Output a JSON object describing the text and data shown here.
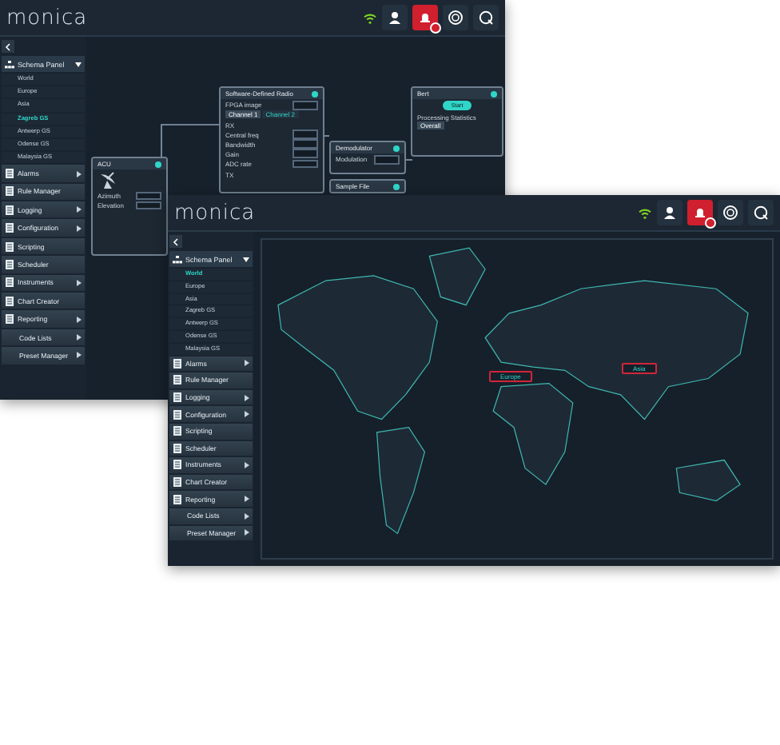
{
  "back_window": {
    "logo": "monica",
    "toolbar": {
      "alarm_active": true
    },
    "sidebar": {
      "schema_panel": {
        "label": "Schema Panel",
        "expanded": true,
        "items": [
          {
            "label": "World",
            "selected": false
          },
          {
            "label": "Europe",
            "selected": false
          },
          {
            "label": "Asia",
            "selected": false
          },
          {
            "label": "Zagreb GS",
            "selected": true
          },
          {
            "label": "Antwerp GS",
            "selected": false
          },
          {
            "label": "Odense GS",
            "selected": false
          },
          {
            "label": "Malaysia GS",
            "selected": false
          }
        ]
      },
      "menu": [
        {
          "label": "Alarms",
          "has_icon": true,
          "has_submenu": true
        },
        {
          "label": "Rule Manager",
          "has_icon": true,
          "has_submenu": false
        },
        {
          "label": "Logging",
          "has_icon": true,
          "has_submenu": true
        },
        {
          "label": "Configuration",
          "has_icon": true,
          "has_submenu": true
        },
        {
          "label": "Scripting",
          "has_icon": true,
          "has_submenu": false
        },
        {
          "label": "Scheduler",
          "has_icon": true,
          "has_submenu": false
        },
        {
          "label": "Instruments",
          "has_icon": true,
          "has_submenu": true
        },
        {
          "label": "Chart Creator",
          "has_icon": true,
          "has_submenu": false
        },
        {
          "label": "Reporting",
          "has_icon": true,
          "has_submenu": true
        },
        {
          "label": "Code Lists",
          "has_icon": false,
          "has_submenu": true
        },
        {
          "label": "Preset Manager",
          "has_icon": false,
          "has_submenu": true
        }
      ]
    },
    "nodes": [
      {
        "kind": "acu",
        "title": "ACU",
        "items": [
          {
            "kind": "field",
            "label": "Azimuth"
          },
          {
            "kind": "field",
            "label": "Elevation"
          }
        ]
      },
      {
        "kind": "panel",
        "title": "Software-Defined Radio",
        "items": [
          {
            "kind": "field",
            "label": "FPGA image"
          },
          {
            "kind": "tabs",
            "tabs": [
              {
                "label": "Channel 1",
                "selected": true
              },
              {
                "label": "Channel 2",
                "selected": false
              }
            ]
          },
          {
            "kind": "section",
            "label": "RX"
          },
          {
            "kind": "field",
            "label": "Central freq"
          },
          {
            "kind": "field",
            "label": "Bandwidth"
          },
          {
            "kind": "field",
            "label": "Gain"
          },
          {
            "kind": "field",
            "label": "ADC rate"
          },
          {
            "kind": "section",
            "label": "TX"
          }
        ]
      },
      {
        "kind": "panel",
        "title": "Demodulator",
        "items": [
          {
            "kind": "field",
            "label": "Modulation"
          }
        ]
      },
      {
        "kind": "panel",
        "title": "Sample File"
      },
      {
        "kind": "panel",
        "title": "Bert",
        "items": [
          {
            "kind": "button",
            "label": "Start"
          },
          {
            "kind": "section",
            "label": "Processing Statistics"
          },
          {
            "kind": "tabs",
            "tabs": [
              {
                "label": "Overall",
                "selected": true
              }
            ]
          }
        ]
      }
    ]
  },
  "front_window": {
    "logo": "monica",
    "toolbar": {
      "alarm_active": true
    },
    "sidebar": {
      "schema_panel": {
        "label": "Schema Panel",
        "expanded": true,
        "items": [
          {
            "label": "World",
            "selected": true
          },
          {
            "label": "Europe",
            "selected": false
          },
          {
            "label": "Asia",
            "selected": false
          },
          {
            "label": "Zagreb GS",
            "selected": false
          },
          {
            "label": "Antwerp GS",
            "selected": false
          },
          {
            "label": "Odense GS",
            "selected": false
          },
          {
            "label": "Malaysia GS",
            "selected": false
          }
        ]
      },
      "menu": [
        {
          "label": "Alarms",
          "has_icon": true,
          "has_submenu": true
        },
        {
          "label": "Rule Manager",
          "has_icon": true,
          "has_submenu": false
        },
        {
          "label": "Logging",
          "has_icon": true,
          "has_submenu": true
        },
        {
          "label": "Configuration",
          "has_icon": true,
          "has_submenu": true
        },
        {
          "label": "Scripting",
          "has_icon": true,
          "has_submenu": false
        },
        {
          "label": "Scheduler",
          "has_icon": true,
          "has_submenu": false
        },
        {
          "label": "Instruments",
          "has_icon": true,
          "has_submenu": true
        },
        {
          "label": "Chart Creator",
          "has_icon": true,
          "has_submenu": false
        },
        {
          "label": "Reporting",
          "has_icon": true,
          "has_submenu": true
        },
        {
          "label": "Code Lists",
          "has_icon": false,
          "has_submenu": true
        },
        {
          "label": "Preset Manager",
          "has_icon": false,
          "has_submenu": true
        }
      ]
    },
    "map": {
      "regions": [
        {
          "label": "Europe"
        },
        {
          "label": "Asia"
        }
      ]
    }
  }
}
